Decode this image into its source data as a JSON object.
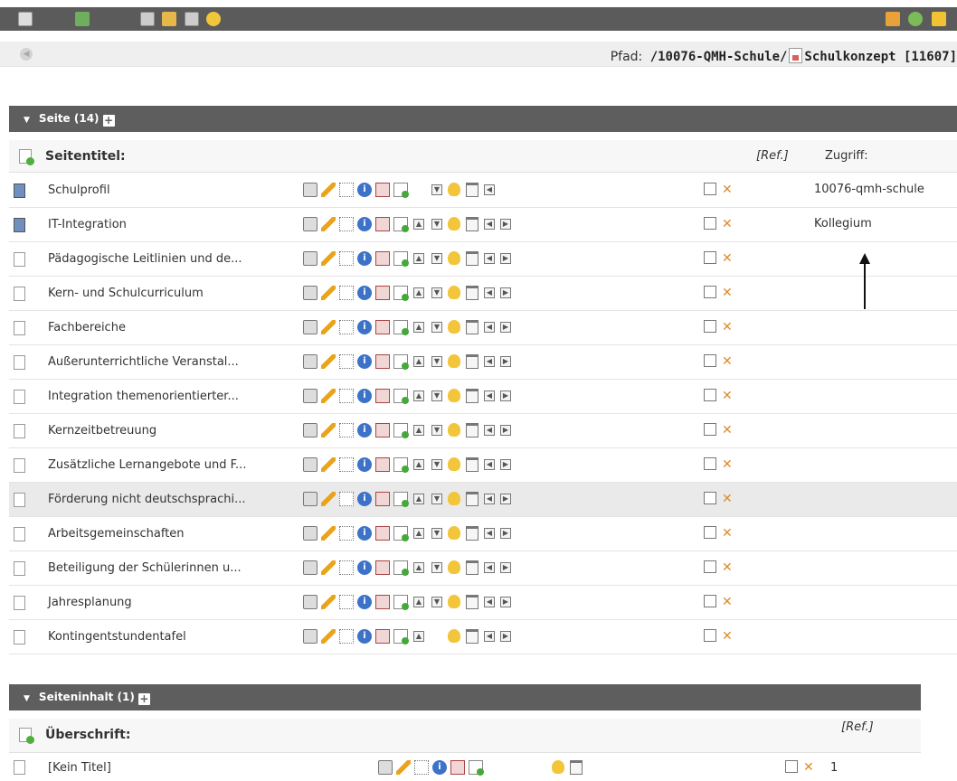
{
  "toolbar": {
    "icons": [
      "export-icon",
      "save-page-icon",
      "view-page-icon",
      "edit-page-icon",
      "new-page-icon",
      "tip-bulb-icon",
      "user-icon",
      "refresh-icon",
      "favorite-star-icon"
    ]
  },
  "path": {
    "label": "Pfad:",
    "value": "/10076-QMH-Schule/",
    "page": "Schulkonzept [11607]"
  },
  "sections": {
    "seite": {
      "label": "Seite (14)",
      "header_title": "Seitentitel:",
      "ref_label": "[Ref.]",
      "access_label": "Zugriff:",
      "rows": [
        {
          "title": "Schulprofil",
          "access": "10076-qmh-schule"
        },
        {
          "title": "IT-Integration",
          "access": "Kollegium"
        },
        {
          "title": "Pädagogische Leitlinien und de...",
          "access": ""
        },
        {
          "title": "Kern- und Schulcurriculum",
          "access": ""
        },
        {
          "title": "Fachbereiche",
          "access": ""
        },
        {
          "title": "Außerunterrichtliche Veranstal...",
          "access": ""
        },
        {
          "title": "Integration themenorientierter...",
          "access": ""
        },
        {
          "title": "Kernzeitbetreuung",
          "access": ""
        },
        {
          "title": "Zusätzliche Lernangebote und F...",
          "access": ""
        },
        {
          "title": "Förderung nicht deutschsprachi...",
          "access": ""
        },
        {
          "title": "Arbeitsgemeinschaften",
          "access": ""
        },
        {
          "title": "Beteiligung der Schülerinnen u...",
          "access": ""
        },
        {
          "title": "Jahresplanung",
          "access": ""
        },
        {
          "title": "Kontingentstundentafel",
          "access": ""
        }
      ]
    },
    "inhalt": {
      "label": "Seiteninhalt (1)",
      "header_title": "Überschrift:",
      "ref_label": "[Ref.]",
      "rows": [
        {
          "title": "[Kein Titel]",
          "number": "1"
        }
      ]
    }
  }
}
